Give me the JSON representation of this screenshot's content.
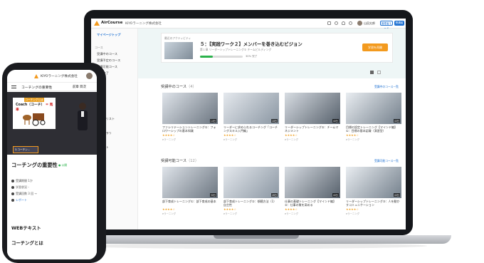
{
  "app": {
    "logo_text": "AirCourse",
    "company": "KIYOラーニング株式会社",
    "user_name": "山田太郎",
    "header_buttons": [
      "管理者モード",
      "受講者",
      "ログアウト"
    ]
  },
  "sidebar": {
    "items": [
      "マイページトップ",
      "受講中のコース",
      "受講予定のコース",
      "受講可能コース",
      "受講完了"
    ],
    "sections": [
      "コース",
      "カテゴリ"
    ],
    "more": [
      "プレイリスト",
      "ライブラリ",
      "レポート",
      "設定"
    ]
  },
  "banner": {
    "label": "最近のアクティビティ",
    "title": "５：【実践ワーク２】メンバーを巻き込むビジョン",
    "subtitle": "第１章 リーダーシップトレーニング② チームビルディング",
    "progress_percent": 30,
    "progress_text": "30% 完了",
    "button": "学習を再開"
  },
  "sections": {
    "in_progress": {
      "title": "受講中のコース",
      "count": "（4）",
      "link": "受講中のコース一覧"
    },
    "available": {
      "title": "受講可能コース",
      "count": "（12）",
      "link": "受講可能コース一覧"
    }
  },
  "courses_in_progress": [
    {
      "title": "ファシリテーショントレーニング①：フォロワーシップの基本知識",
      "stars": "★★★★☆",
      "type": "eラーニング",
      "time": "14分"
    },
    {
      "title": "リーダーに求められるコーチング「コーチングスキル入門編」",
      "stars": "★★★★☆",
      "type": "eラーニング",
      "time": "18分"
    },
    {
      "title": "リーダーシップトレーニング②：チームマネジメント",
      "stars": "★★★★☆",
      "type": "eラーニング",
      "time": "40分"
    },
    {
      "title": "目標の設定トレーニング【マインド編】①：目標の基本認識（演習型）",
      "stars": "★★★★☆",
      "type": "eラーニング",
      "time": "40分"
    }
  ],
  "courses_available": [
    {
      "title": "部下育成トレーニング①：部下育成の基本",
      "stars": "★★★★☆",
      "type": "eラーニング",
      "time": "30分"
    },
    {
      "title": "部下育成トレーニング②：傾聴方法（1）自主性",
      "stars": "★★★★☆",
      "type": "eラーニング",
      "time": "28分"
    },
    {
      "title": "仕事の基礎トレーニング【マインド編】②：仕事の質を高める",
      "stars": "★★★★☆",
      "type": "eラーニング",
      "time": "40分"
    },
    {
      "title": "リーダーシップトレーニング③：人を動かすコミュニケーション",
      "stars": "★★★★☆",
      "type": "eラーニング",
      "time": "40分"
    }
  ],
  "phone": {
    "company": "KIYOラーニング株式会社",
    "bar_title": "コーチングの重要性",
    "bar_right": "前章 目次",
    "slide_head": "コーチングとは",
    "slide_title": "Coach（コーチ）",
    "slide_tag": "= 馬車",
    "chip_text": "3.コーチン...",
    "course_title": "コーチングの重要性",
    "badge": "● 公開",
    "rows": [
      "受講期間 1か",
      "学習状況 -",
      "受講回数 3 回 →",
      "レポート"
    ],
    "section1": "WEBテキスト",
    "section2": "コーチングとは"
  }
}
